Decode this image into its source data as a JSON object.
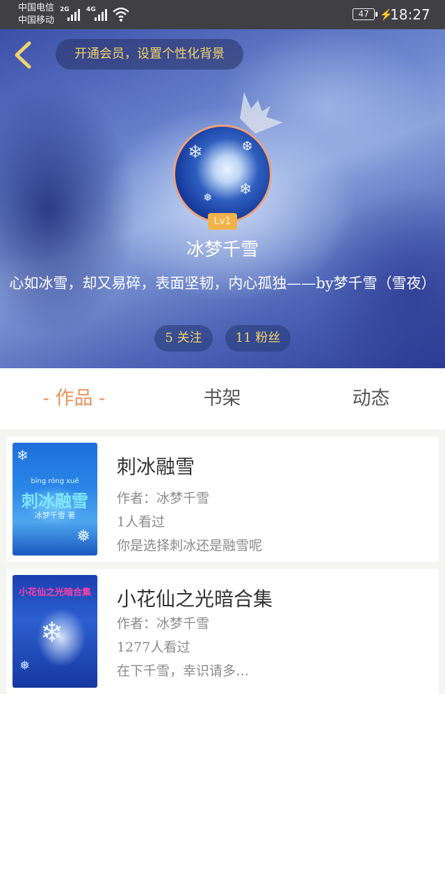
{
  "status_bar": {
    "carrier_1": "中国电信",
    "carrier_2": "中国移动",
    "network_1": "2G",
    "network_2": "4G",
    "battery": "47",
    "time": "18:27"
  },
  "header": {
    "vip_banner": "开通会员，设置个性化背景",
    "level": "Lv1",
    "nickname": "冰梦千雪",
    "bio": "心如冰雪，却又易碎，表面坚韧，内心孤独——by梦千雪（雪夜）",
    "following": "5 关注",
    "followers": "11 粉丝"
  },
  "tabs": [
    {
      "label": "- 作品 -",
      "active": true
    },
    {
      "label": "书架",
      "active": false
    },
    {
      "label": "动态",
      "active": false
    }
  ],
  "books": [
    {
      "title": "刺冰融雪",
      "author": "作者：冰梦千雪",
      "views": "1人看过",
      "intro": "你是选择刺冰还是融雪呢",
      "cover_text": "刺冰融雪",
      "cover_pinyin": "bīng róng xuě",
      "cover_author": "冰梦千雪 著"
    },
    {
      "title": "小花仙之光暗合集",
      "author": "作者：冰梦千雪",
      "views": "1277人看过",
      "intro": "在下千雪，幸识请多…",
      "cover_text": "小花仙之光暗合集"
    }
  ],
  "colors": {
    "accent": "#e8915a",
    "gold": "#f3d36b",
    "status_bar": "#3f3f44",
    "level_badge": "#f2b24a"
  }
}
